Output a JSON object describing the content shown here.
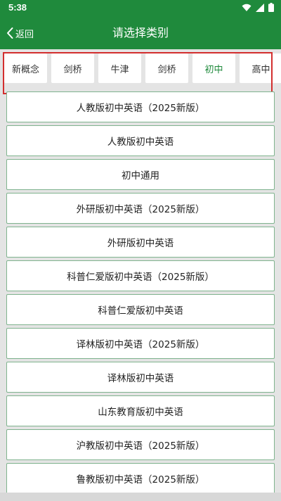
{
  "status": {
    "time": "5:38"
  },
  "nav": {
    "back_label": "返回",
    "title": "请选择类别"
  },
  "tabs": [
    {
      "label": "新概念",
      "active": false
    },
    {
      "label": "剑桥",
      "active": false
    },
    {
      "label": "牛津",
      "active": false
    },
    {
      "label": "剑桥",
      "active": false
    },
    {
      "label": "初中",
      "active": true
    },
    {
      "label": "高中",
      "active": false
    }
  ],
  "items": [
    "人教版初中英语（2025新版）",
    "人教版初中英语",
    "初中通用",
    "外研版初中英语（2025新版）",
    "外研版初中英语",
    "科普仁爱版初中英语（2025新版）",
    "科普仁爱版初中英语",
    "译林版初中英语（2025新版）",
    "译林版初中英语",
    "山东教育版初中英语",
    "沪教版初中英语（2025新版）",
    "鲁教版初中英语（2025新版）"
  ],
  "colors": {
    "primary": "#1f8a3c",
    "highlight": "#d32f2f"
  }
}
